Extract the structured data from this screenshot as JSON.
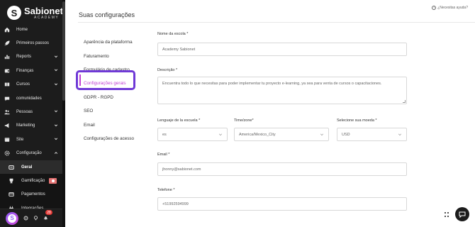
{
  "brand": {
    "name": "Sabionet",
    "subtitle": "ACADEMY",
    "logo_letter": "S"
  },
  "sidebar": {
    "items": [
      {
        "label": "Home",
        "icon": "home-icon",
        "has_chevron": false
      },
      {
        "label": "Primeiros passos",
        "icon": "rocket-icon",
        "has_chevron": false
      },
      {
        "label": "Reports",
        "icon": "chart-icon",
        "has_chevron": true
      },
      {
        "label": "Finanças",
        "icon": "wallet-icon",
        "has_chevron": true
      },
      {
        "label": "Cursos",
        "icon": "book-icon",
        "has_chevron": true
      },
      {
        "label": "comunidades",
        "icon": "chat-icon",
        "has_chevron": false
      },
      {
        "label": "Pessoas",
        "icon": "people-icon",
        "has_chevron": true
      },
      {
        "label": "Marketing",
        "icon": "megaphone-icon",
        "has_chevron": true
      },
      {
        "label": "Site",
        "icon": "globe-icon",
        "has_chevron": true
      },
      {
        "label": "Configuração",
        "icon": "gear-icon",
        "has_chevron": true,
        "expanded": true
      }
    ],
    "subitems": [
      {
        "label": "Geral",
        "icon": "home-sub-icon",
        "active": true
      },
      {
        "label": "Gamificação",
        "icon": "trophy-icon",
        "active": false
      },
      {
        "label": "Pagamentos",
        "icon": "card-icon",
        "active": false
      },
      {
        "label": "Integrações",
        "icon": "plug-icon",
        "active": false
      }
    ],
    "notification_count": "28"
  },
  "header": {
    "title": "Suas configurações",
    "help_label": "¿Necesitas ayuda?"
  },
  "subnav": {
    "items": [
      "Aparência da plataforma",
      "Faturamento",
      "Formulário de cadastro",
      "Configurações gerais",
      "GDPR - RGPD",
      "SEO",
      "Email",
      "Configurações de acesso"
    ],
    "active_index": 3
  },
  "form": {
    "school_name_label": "Nome da escola *",
    "school_name_value": "Academy Sabionet",
    "description_label": "Descrição *",
    "description_value": "Encuentra todo lo que necesitas para poder implementar tu proyecto e-learning, ya sea para venta de cursos o capacitaciones.",
    "language_label": "Lenguaje de la escuela *",
    "language_value": "es",
    "timezone_label": "Time/zone*",
    "timezone_value": "America/Mexico_City",
    "currency_label": "Selecione sua moeda *",
    "currency_value": "USD",
    "email_label": "Email *",
    "email_value": "jhonny@sabionet.com",
    "phone_label": "Telefone *",
    "phone_value": "+51992594999"
  },
  "colors": {
    "sidebar_bg": "#1c1c1c",
    "accent": "#c23fd3",
    "highlight_border": "#6f39d6"
  }
}
